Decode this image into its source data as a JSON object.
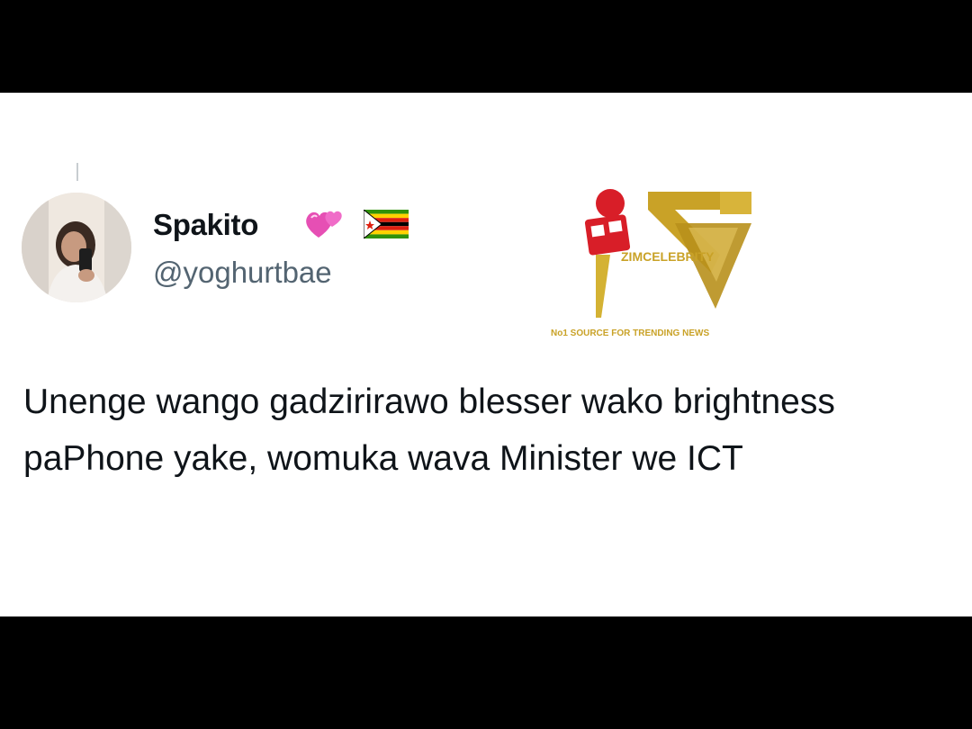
{
  "tweet": {
    "display_name": "Spakito",
    "handle": "@yoghurtbae",
    "badges": [
      "two-hearts-icon",
      "zimbabwe-flag-icon"
    ],
    "text": "Unenge wango gadzirirawo blesser wako brightness paPhone yake, womuka wava Minister we ICT"
  },
  "watermark": {
    "brand": "ZIMCELEBRITY",
    "tagline": "No1 SOURCE FOR TRENDING NEWS",
    "icon": "microphone-icon"
  },
  "colors": {
    "text_primary": "#0f1419",
    "text_secondary": "#536471",
    "logo_gold": "#c9a227",
    "mic_red": "#d81e28",
    "frame": "#000000"
  }
}
